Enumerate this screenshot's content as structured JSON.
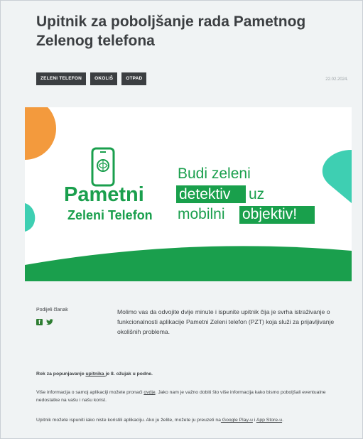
{
  "article": {
    "title": "Upitnik za poboljšanje rada Pametnog Zelenog telefona",
    "tags": [
      "ZELENI TELEFON",
      "OKOLIŠ",
      "OTPAD"
    ],
    "date": "22.02.2024."
  },
  "banner": {
    "brand_line1": "Pametni",
    "brand_line2": "Zeleni Telefon",
    "slogan_line1": "Budi zeleni",
    "slogan_hl1": "detektiv",
    "slogan_rest2": "uz",
    "slogan_line3": "mobilni",
    "slogan_hl3": "objektiv!",
    "colors": {
      "green": "#1a9f4d",
      "orange": "#f39a3d",
      "mint": "#3ecfb2",
      "highlight": "#19a04c"
    },
    "icons": [
      "phone-brain-icon"
    ]
  },
  "share": {
    "label": "Podijeli članak",
    "icons": [
      "facebook-icon",
      "twitter-icon"
    ]
  },
  "body": {
    "lead": "Molimo vas da odvojite dvije minute i ispunite upitnik čija je svrha istraživanje o funkcionalnosti aplikacije Pametni Zeleni telefon (PZT) koja služi za prijavljivanje okolišnih problema.",
    "p1_before": "Rok za popunjavanje ",
    "p1_link": "upitnika ",
    "p1_after": "je 8. ožujak u podne.",
    "p2_before": "Više informacija o samoj aplikaciji možete pronaći ",
    "p2_link": "ovdje",
    "p2_after": ". Jako nam je važno dobiti što više informacija kako bismo poboljšali eventualne nedostatke na vašu i našu korist.",
    "p3_before": "Upitnik možete ispuniti iako niste koristili aplikaciju. Ako ju želite, možete ju preuzeti na",
    "p3_link1": " Google Play-u",
    "p3_mid": " i ",
    "p3_link2": "App Store-u",
    "p3_after": "."
  }
}
